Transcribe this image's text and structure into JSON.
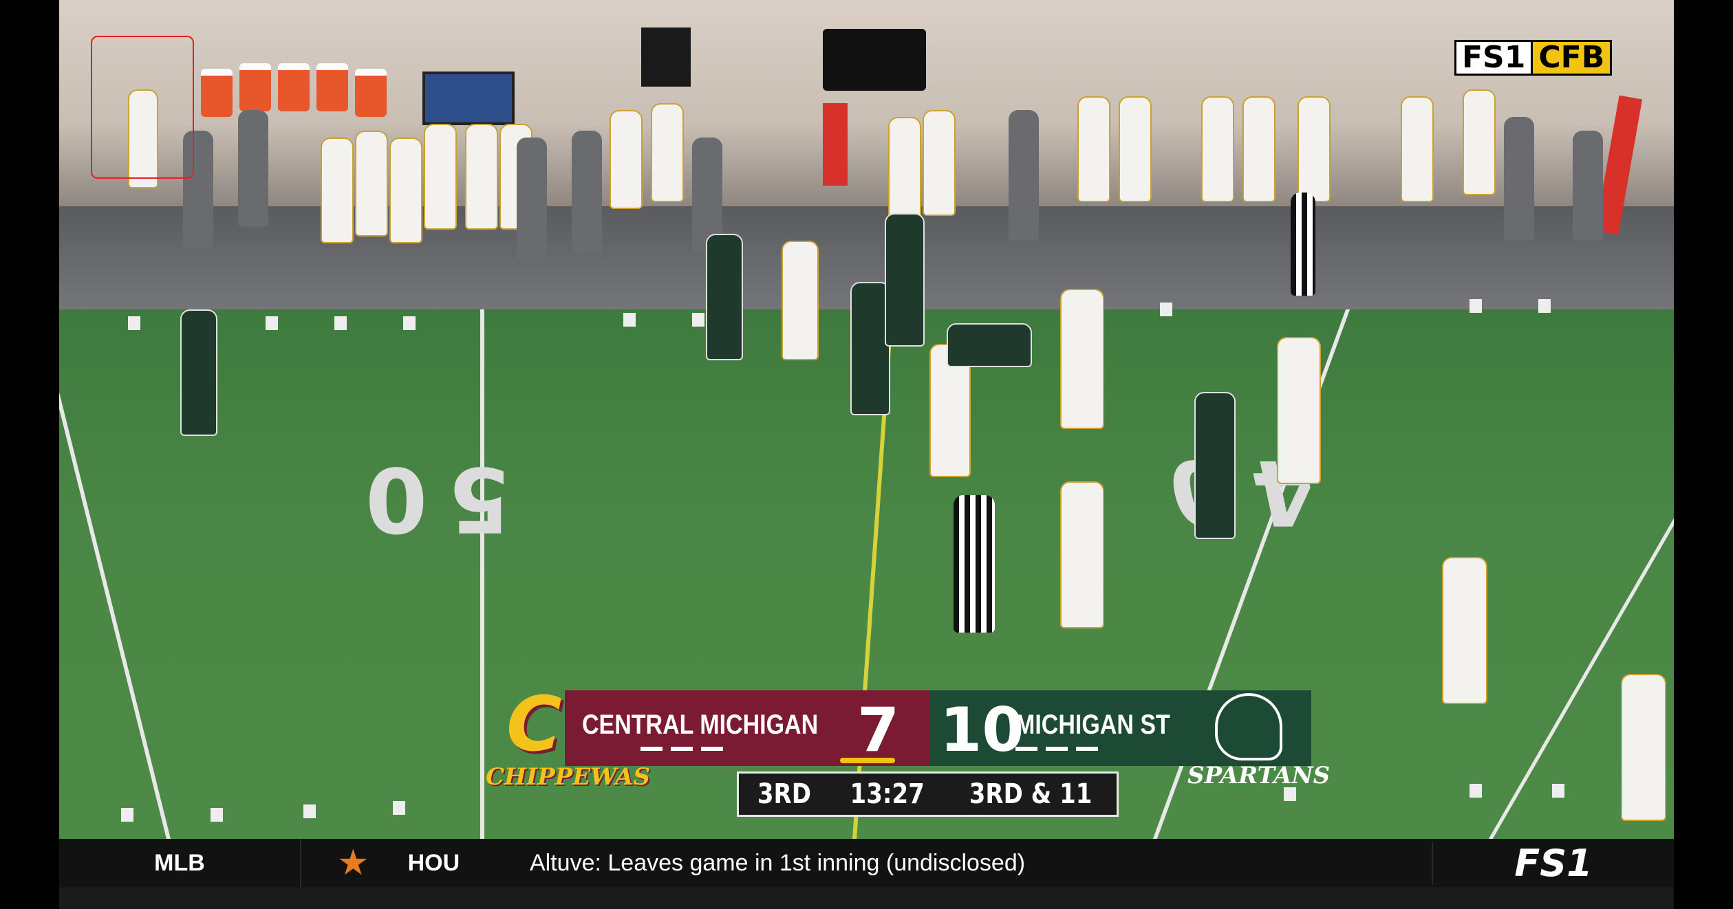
{
  "network_logo": {
    "left": "FS1",
    "right": "CFB"
  },
  "scorebug": {
    "home": {
      "name": "CENTRAL MICHIGAN",
      "score": "7",
      "wordmark": "CHIPPEWAS",
      "color": "#7a1a33"
    },
    "away": {
      "name": "MICHIGAN ST",
      "score": "10",
      "wordmark": "SPARTANS",
      "color": "#1c4a35"
    },
    "quarter": "3RD",
    "clock": "13:27",
    "down_distance": "3RD & 11",
    "possession_color": "#f2c312"
  },
  "field": {
    "yard_number_left": "50",
    "yard_number_right": "40"
  },
  "ticker": {
    "league": "MLB",
    "team_icon": "astros-star-icon",
    "team": "HOU",
    "headline": "Altuve: Leaves game in 1st inning (undisclosed)",
    "network": "FS1"
  }
}
